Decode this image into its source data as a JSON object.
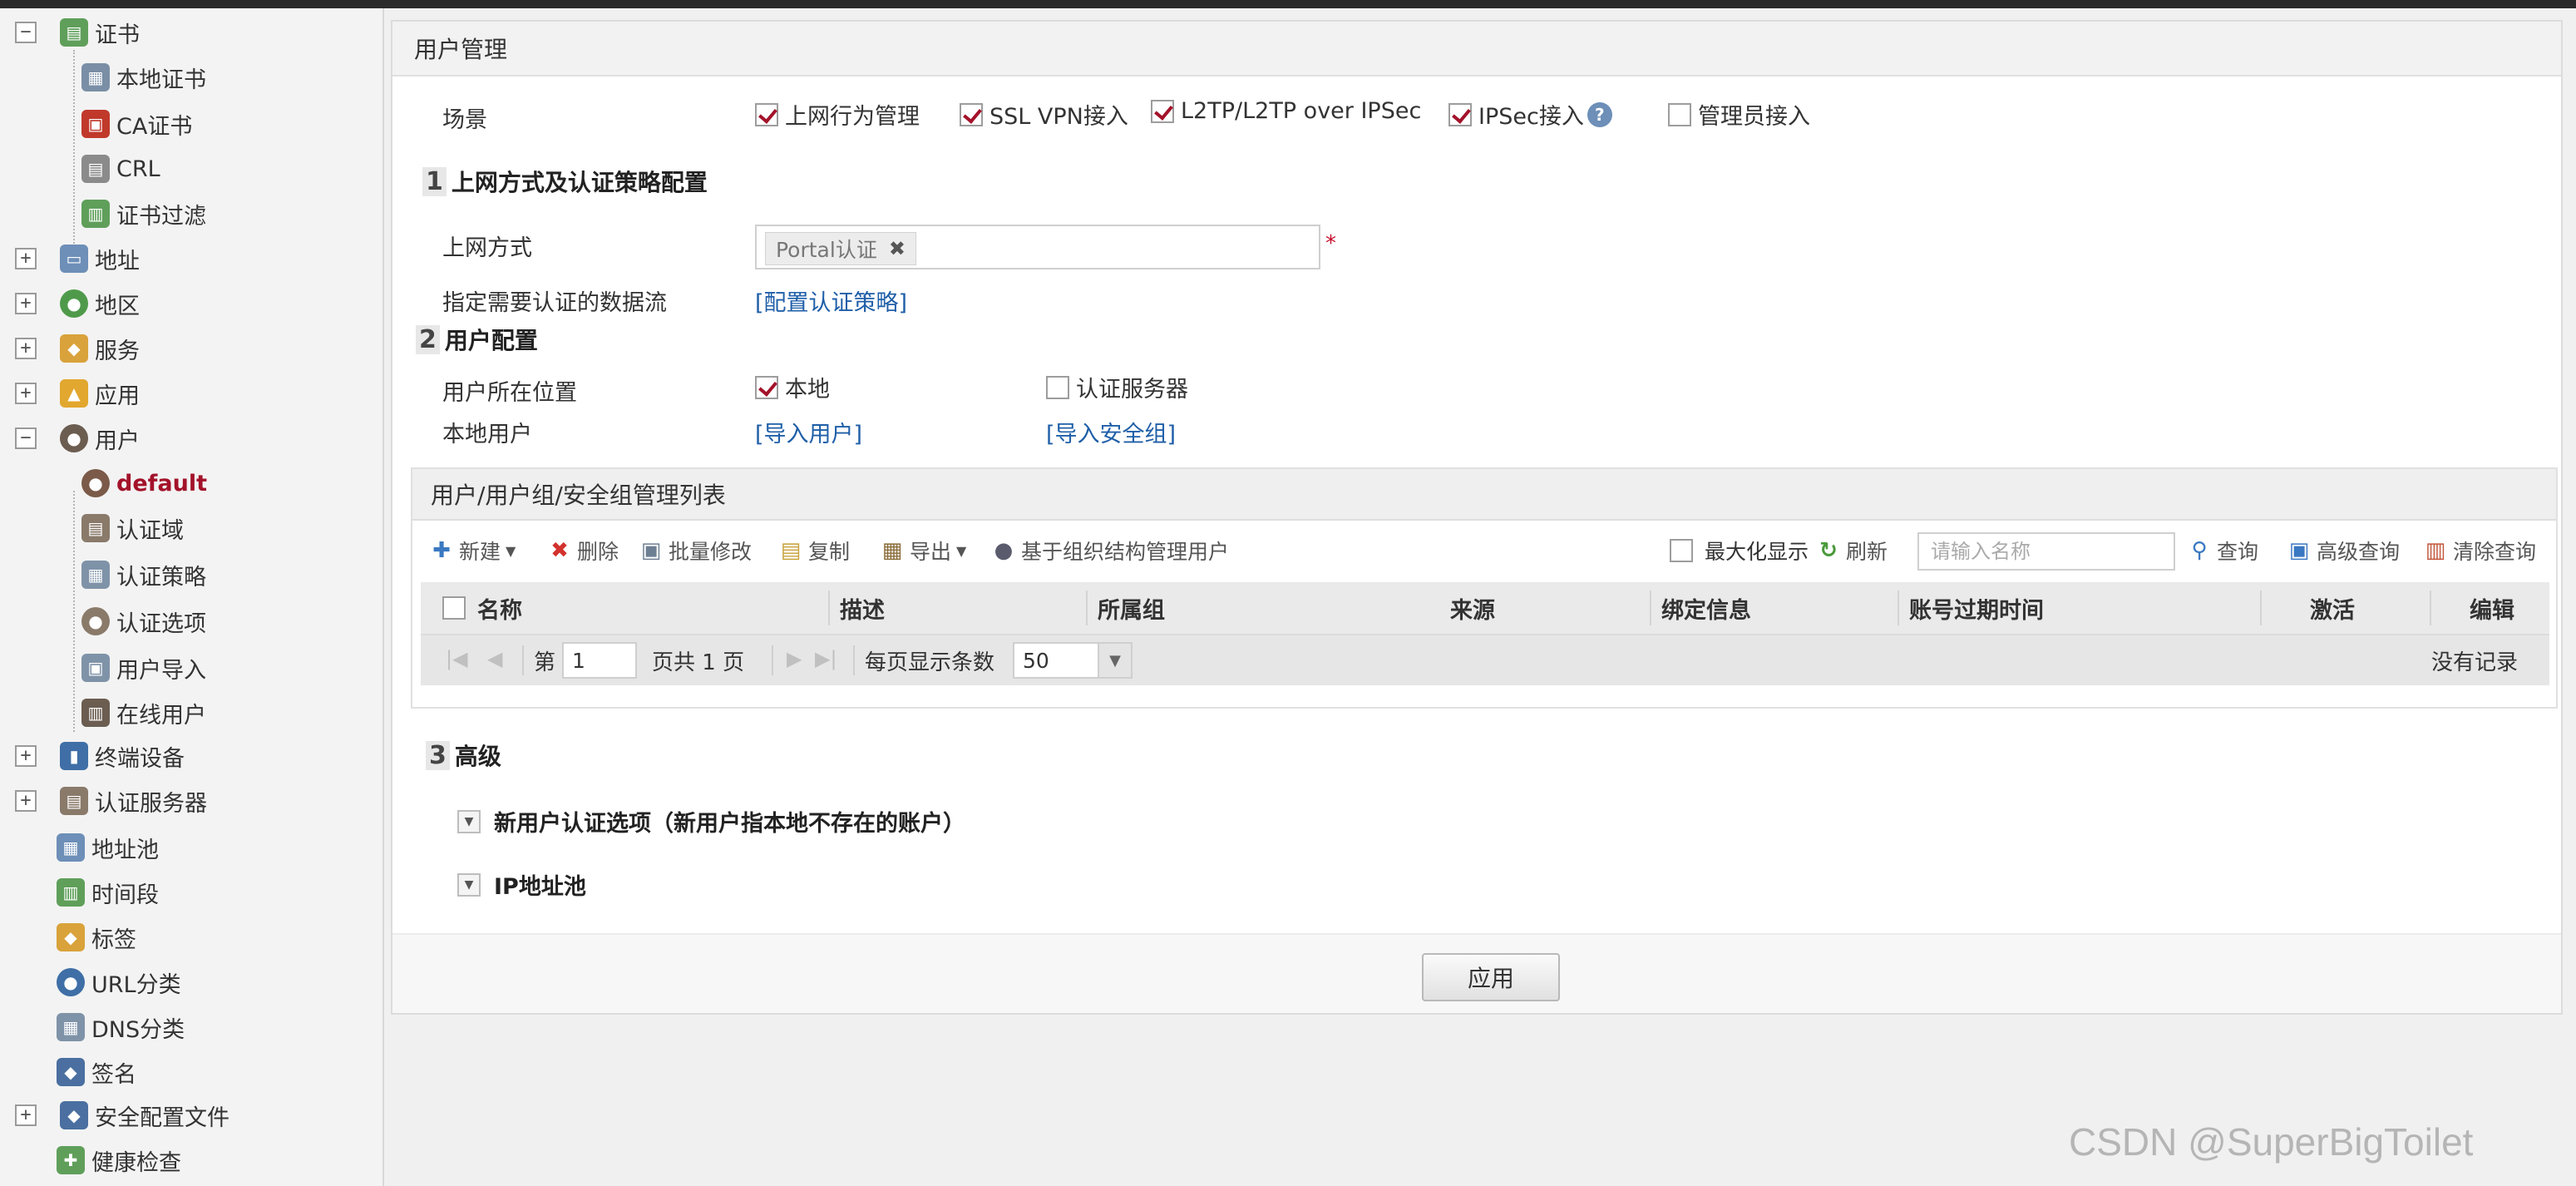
{
  "sidebar": {
    "items": [
      {
        "label": "证书",
        "toggle": "−"
      },
      {
        "label": "本地证书"
      },
      {
        "label": "CA证书"
      },
      {
        "label": "CRL"
      },
      {
        "label": "证书过滤"
      },
      {
        "label": "地址",
        "toggle": "+"
      },
      {
        "label": "地区",
        "toggle": "+"
      },
      {
        "label": "服务",
        "toggle": "+"
      },
      {
        "label": "应用",
        "toggle": "+"
      },
      {
        "label": "用户",
        "toggle": "−"
      },
      {
        "label": "default"
      },
      {
        "label": "认证域"
      },
      {
        "label": "认证策略"
      },
      {
        "label": "认证选项"
      },
      {
        "label": "用户导入"
      },
      {
        "label": "在线用户"
      },
      {
        "label": "终端设备",
        "toggle": "+"
      },
      {
        "label": "认证服务器",
        "toggle": "+"
      },
      {
        "label": "地址池"
      },
      {
        "label": "时间段"
      },
      {
        "label": "标签"
      },
      {
        "label": "URL分类"
      },
      {
        "label": "DNS分类"
      },
      {
        "label": "签名"
      },
      {
        "label": "安全配置文件",
        "toggle": "+"
      },
      {
        "label": "健康检查"
      }
    ]
  },
  "panel": {
    "title": "用户管理",
    "scene_label": "场景",
    "scenes": [
      {
        "label": "上网行为管理",
        "checked": true
      },
      {
        "label": "SSL VPN接入",
        "checked": true
      },
      {
        "label": "L2TP/L2TP over IPSec",
        "checked": true
      },
      {
        "label": "IPSec接入",
        "checked": true
      },
      {
        "label": "管理员接入",
        "checked": false
      }
    ],
    "help_glyph": "?",
    "section1": {
      "num": "1",
      "title": "上网方式及认证策略配置",
      "access_label": "上网方式",
      "access_tag": "Portal认证",
      "tag_remove": "✖",
      "required_mark": "*",
      "flow_label": "指定需要认证的数据流",
      "flow_link": "[配置认证策略]"
    },
    "section2": {
      "num": "2",
      "title": "用户配置",
      "location_label": "用户所在位置",
      "location_local": "本地",
      "location_local_checked": true,
      "location_server": "认证服务器",
      "location_server_checked": false,
      "local_user_label": "本地用户",
      "import_users_link": "[导入用户]",
      "import_groups_link": "[导入安全组]"
    },
    "list": {
      "title": "用户/用户组/安全组管理列表",
      "toolbar": {
        "new": "新建",
        "delete": "删除",
        "batch_edit": "批量修改",
        "copy": "复制",
        "export": "导出",
        "org_manage": "基于组织结构管理用户",
        "maximize": "最大化显示",
        "refresh": "刷新",
        "search_placeholder": "请输入名称",
        "query": "查询",
        "advanced_query": "高级查询",
        "clear_query": "清除查询"
      },
      "columns": [
        "名称",
        "描述",
        "所属组",
        "来源",
        "绑定信息",
        "账号过期时间",
        "激活",
        "编辑"
      ],
      "pager": {
        "page_prefix": "第",
        "page_value": "1",
        "page_suffix": "页共 1 页",
        "per_page_label": "每页显示条数",
        "per_page_value": "50",
        "empty_text": "没有记录"
      }
    },
    "section3": {
      "num": "3",
      "title": "高级",
      "items": [
        "新用户认证选项（新用户指本地不存在的账户）",
        "IP地址池"
      ]
    },
    "apply_label": "应用"
  },
  "watermark": "CSDN @SuperBigToilet",
  "colors": {
    "accent": "#a3122a",
    "link": "#1f5fa8",
    "required": "#c8102e"
  }
}
